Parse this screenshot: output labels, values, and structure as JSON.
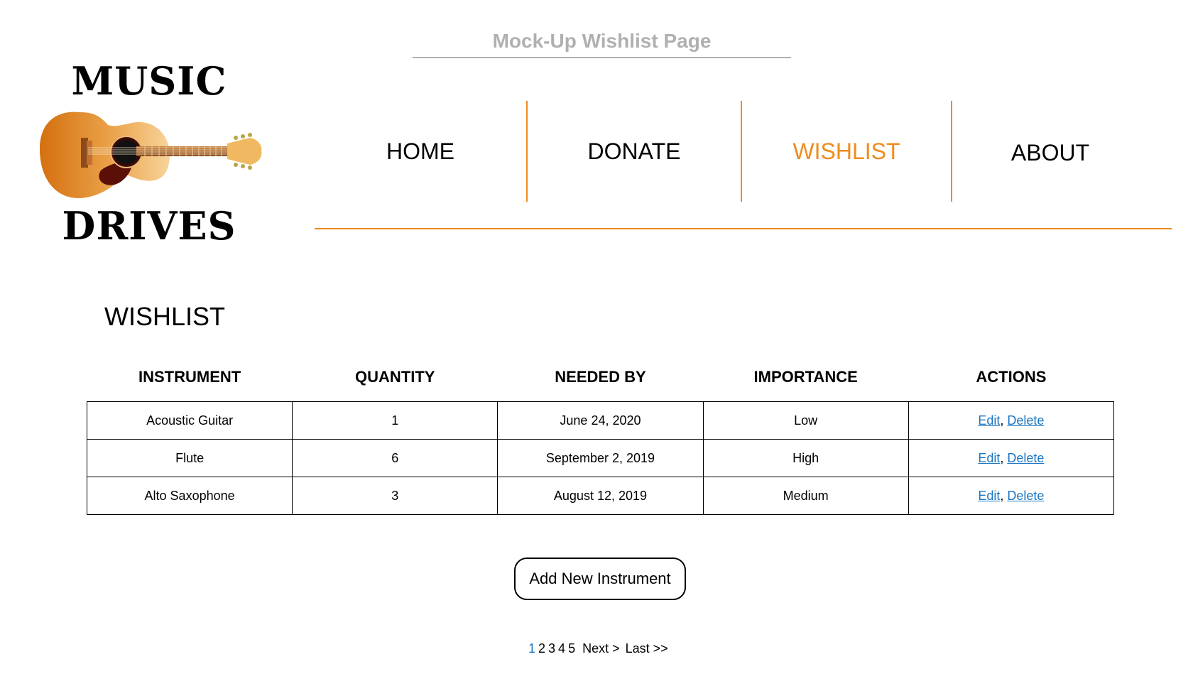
{
  "page": {
    "mock_title": "Mock-Up Wishlist Page"
  },
  "logo": {
    "top_word": "MUSIC",
    "bottom_word": "DRIVES",
    "image_icon": "acoustic-guitar-icon"
  },
  "nav": {
    "items": [
      {
        "label": "HOME",
        "active": false
      },
      {
        "label": "DONATE",
        "active": false
      },
      {
        "label": "WISHLIST",
        "active": true
      },
      {
        "label": "ABOUT",
        "active": false
      }
    ],
    "accent_color": "#ef8c1d"
  },
  "wishlist": {
    "title": "WISHLIST",
    "columns": [
      "INSTRUMENT",
      "QUANTITY",
      "NEEDED BY",
      "IMPORTANCE",
      "ACTIONS"
    ],
    "rows": [
      {
        "instrument": "Acoustic Guitar",
        "quantity": "1",
        "needed_by": "June 24, 2020",
        "importance": "Low",
        "edit": "Edit",
        "delete": "Delete"
      },
      {
        "instrument": "Flute",
        "quantity": "6",
        "needed_by": "September 2, 2019",
        "importance": "High",
        "edit": "Edit",
        "delete": "Delete"
      },
      {
        "instrument": "Alto Saxophone",
        "quantity": "3",
        "needed_by": "August 12, 2019",
        "importance": "Medium",
        "edit": "Edit",
        "delete": "Delete"
      }
    ],
    "link_color": "#1a76c2"
  },
  "add_button": {
    "label": "Add New Instrument"
  },
  "pagination": {
    "pages": [
      "1",
      "2",
      "3",
      "4",
      "5"
    ],
    "current": "1",
    "next": "Next >",
    "last": "Last >>"
  }
}
